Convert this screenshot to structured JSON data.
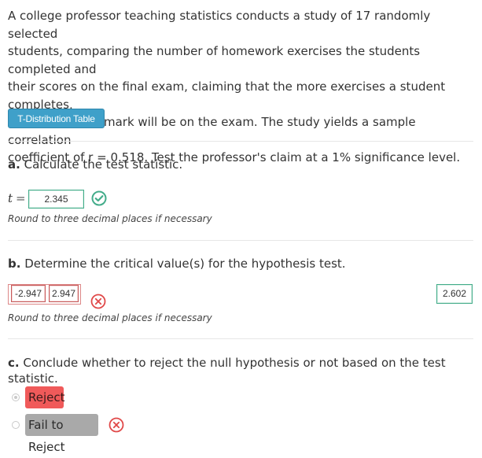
{
  "problem": {
    "lines": [
      "A college professor teaching statistics conducts a study of 17 randomly selected",
      "students, comparing the number of homework exercises the students completed and",
      "their scores on the final exam, claiming that the more exercises a student completes,",
      "the higher their mark will be on the exam. The study yields a sample correlation",
      "coefficient of r = 0.518. Test the professor's claim at a 1% significance level."
    ]
  },
  "table_button": {
    "label": "T-Distribution Table"
  },
  "part_a": {
    "prefix": "a.",
    "question": " Calculate the test statistic.",
    "var": "t",
    "eq": "=",
    "answer": "2.345",
    "status": "correct",
    "hint": "Round to three decimal places if necessary"
  },
  "part_b": {
    "prefix": "b.",
    "question": " Determine the critical value(s) for the hypothesis test.",
    "answers": [
      "-2.947",
      "2.947"
    ],
    "status": "incorrect",
    "correct_answer": "2.602",
    "hint": "Round to three decimal places if necessary"
  },
  "part_c": {
    "prefix": "c.",
    "question": " Conclude whether to reject the null hypothesis or not based on the test statistic.",
    "options": [
      {
        "label": "Reject",
        "selected": true
      },
      {
        "label": "Fail to Reject",
        "selected": false
      }
    ],
    "status": "incorrect"
  },
  "colors": {
    "correct": "#43ac8a",
    "incorrect": "#e04848",
    "button": "#3fa0c9",
    "reject_bg": "#f05a5a",
    "fail_bg": "#a9a9a9"
  }
}
